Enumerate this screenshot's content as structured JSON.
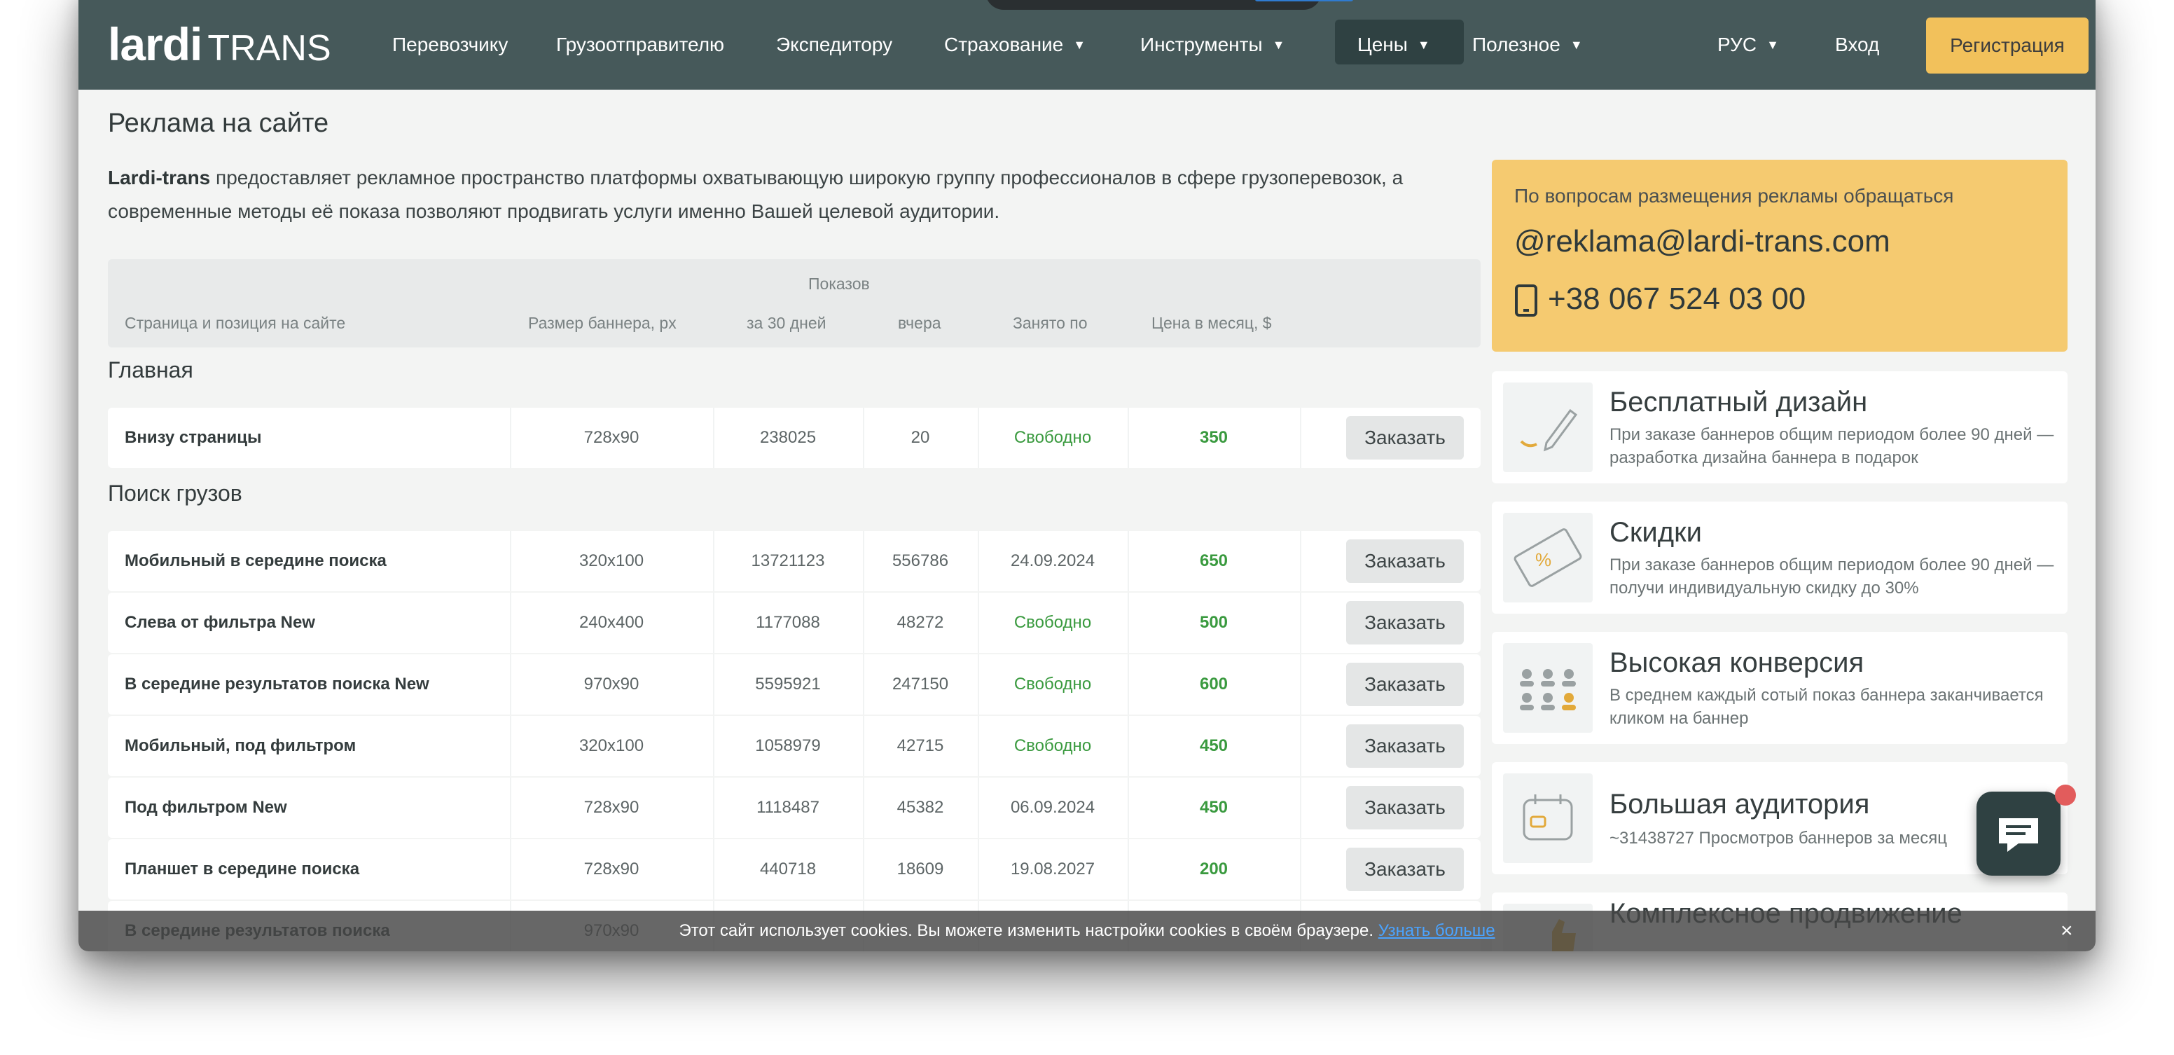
{
  "header": {
    "logo_main": "lardi",
    "logo_sub": "TRANS",
    "nav": [
      {
        "label": "Перевозчику"
      },
      {
        "label": "Грузоотправителю"
      },
      {
        "label": "Экспедитору"
      },
      {
        "label": "Страхование"
      },
      {
        "label": "Инструменты"
      },
      {
        "label": "Цены"
      },
      {
        "label": "Полезное"
      }
    ],
    "language": "РУС",
    "login": "Вход",
    "register": "Регистрация"
  },
  "page": {
    "title": "Реклама на сайте",
    "intro_brand": "Lardi-trans",
    "intro_text": " предоставляет рекламное пространство платформы охватывающую широкую группу профессионалов в сфере грузоперевозок, а современные методы её показа позволяют продвигать услуги именно Вашей целевой аудитории."
  },
  "table": {
    "group_header": "Показов",
    "columns": {
      "page": "Страница и позиция на сайте",
      "size": "Размер баннера, px",
      "views30": "за 30 дней",
      "yesterday": "вчера",
      "busy": "Занято по",
      "price": "Цена в месяц, $"
    },
    "order_label": "Заказать",
    "sections": [
      {
        "title": "Главная",
        "rows": [
          {
            "name": "Внизу страницы",
            "size": "728x90",
            "views30": "238025",
            "yesterday": "20",
            "busy": "Свободно",
            "price": "350"
          }
        ]
      },
      {
        "title": "Поиск грузов",
        "rows": [
          {
            "name": "Мобильный в середине поиска",
            "size": "320x100",
            "views30": "13721123",
            "yesterday": "556786",
            "busy": "24.09.2024",
            "price": "650"
          },
          {
            "name": "Слева от фильтра New",
            "size": "240x400",
            "views30": "1177088",
            "yesterday": "48272",
            "busy": "Свободно",
            "price": "500"
          },
          {
            "name": "В середине результатов поиска New",
            "size": "970x90",
            "views30": "5595921",
            "yesterday": "247150",
            "busy": "Свободно",
            "price": "600"
          },
          {
            "name": "Мобильный, под фильтром",
            "size": "320x100",
            "views30": "1058979",
            "yesterday": "42715",
            "busy": "Свободно",
            "price": "450"
          },
          {
            "name": "Под фильтром New",
            "size": "728x90",
            "views30": "1118487",
            "yesterday": "45382",
            "busy": "06.09.2024",
            "price": "450"
          },
          {
            "name": "Планшет в середине поиска",
            "size": "728x90",
            "views30": "440718",
            "yesterday": "18609",
            "busy": "19.08.2027",
            "price": "200"
          },
          {
            "name": "В середине результатов поиска",
            "size": "970x90",
            "views30": "",
            "yesterday": "",
            "busy": "",
            "price": ""
          }
        ]
      }
    ]
  },
  "contact": {
    "heading": "По вопросам размещения рекламы обращаться",
    "email": "reklama@lardi-trans.com",
    "phone": "+38 067 524 03 00"
  },
  "features": [
    {
      "title": "Бесплатный дизайн",
      "text": "При заказе баннеров общим периодом более 90 дней — разработка дизайна баннера в подарок",
      "icon": "pencil-icon"
    },
    {
      "title": "Скидки",
      "text": "При заказе баннеров общим периодом более 90 дней — получи индивидуальную скидку до 30%",
      "icon": "discount-ticket-icon"
    },
    {
      "title": "Высокая конверсия",
      "text": "В среднем каждый сотый показ баннера заканчивается кликом на баннер",
      "icon": "audience-icon"
    },
    {
      "title": "Большая аудитория",
      "text": "~31438727 Просмотров баннеров за месяц",
      "icon": "calendar-icon"
    },
    {
      "title": "Комплексное продвижение",
      "text": "",
      "icon": "thumbs-up-icon"
    }
  ],
  "cookie": {
    "text": "Этот сайт использует cookies. Вы можете изменить настройки cookies в своём браузере. ",
    "link": "Узнать больше",
    "close": "×"
  },
  "colors": {
    "header_bg": "#46595a",
    "accent_yellow": "#f2c15b",
    "green_status": "#3a9a3f",
    "page_bg": "#f3f4f3"
  }
}
